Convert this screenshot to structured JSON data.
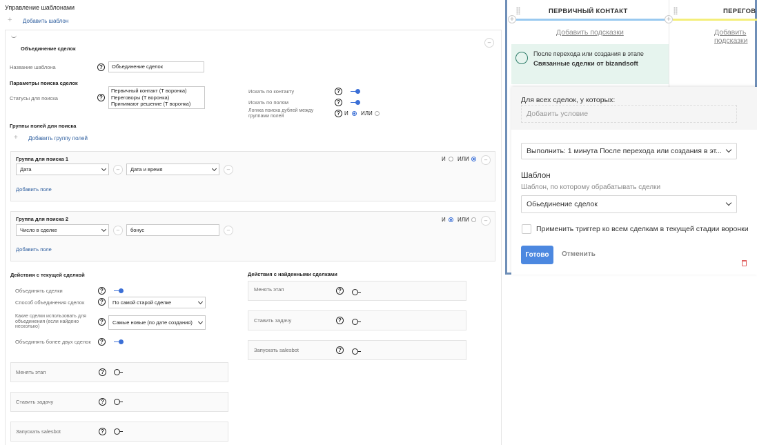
{
  "page": {
    "title": "Управление шаблонами",
    "add_template": "Добавить шаблон"
  },
  "template": {
    "heading": "Объединение сделок",
    "name_label": "Название шаблона",
    "name_value": "Объединение сделок",
    "search_params_heading": "Параметры поиска сделок",
    "statuses_label": "Статусы для поиска",
    "statuses": [
      "Первичный контакт (Т воронка)",
      "Переговоры (Т воронка)",
      "Принимают решение (Т воронка)"
    ],
    "search_by_contact": "Искать по контакту",
    "search_by_fields": "Искать по полям",
    "logic_label": "Логика поиска дублей между группами полей",
    "and": "И",
    "or": "ИЛИ",
    "field_groups_heading": "Группы полей для поиска",
    "add_field_group": "Добавить группу полей",
    "groups": [
      {
        "title": "Группа для поиска 1",
        "field": "Дата",
        "type": "Дата и время",
        "add_field": "Добавить поле",
        "and": "И",
        "or": "ИЛИ",
        "selected": "or"
      },
      {
        "title": "Группа для поиска 2",
        "field": "Число в сделке",
        "type": "бонус",
        "add_field": "Добавить поле",
        "and": "И",
        "or": "ИЛИ",
        "selected": "and"
      }
    ],
    "current_actions_heading": "Действия с текущей сделкой",
    "merge_deals": "Объединять сделки",
    "merge_method_label": "Способ объединения сделок",
    "merge_method_value": "По самой старой сделке",
    "which_deals_label": "Какие сделки использовать для объединения (если найдено несколько)",
    "which_deals_value": "Самые новые (по дате создания)",
    "merge_more_than_two": "Объединять более двух сделок",
    "current_cards": [
      "Менять этап",
      "Ставить задачу",
      "Запускать salesbot"
    ],
    "found_actions_heading": "Действия с найденными сделками",
    "found_cards": [
      "Менять этап",
      "Ставить задачу",
      "Запускать salesbot"
    ]
  },
  "panel": {
    "col1": "ПЕРВИЧНЫЙ КОНТАКТ",
    "col2": "ПЕРЕГОВ",
    "add_hint": "Добавить подсказки",
    "trigger_line1": "После перехода или создания в этапе",
    "trigger_line2": "Связанные сделки от bizandsoft",
    "for_all": "Для всех сделок, у которых:",
    "add_condition": "Добавить условие",
    "execute_value": "Выполнить: 1 минута После перехода или создания в эт...",
    "template_label": "Шаблон",
    "template_hint": "Шаблон, по которому обрабатывать сделки",
    "template_value": "Обьединение сделок",
    "apply_all": "Применить триггер ко всем сделкам в текущей стадии воронки",
    "done": "Готово",
    "cancel": "Отменить"
  },
  "colors": {
    "accent": "#3b6fd6",
    "link": "#2c5d9e",
    "panel_border": "#6f8fb8",
    "stage_bar_1": "#99c9f0",
    "stage_bar_2": "#f4ee7a",
    "trigger_bg": "#e6f4ee"
  }
}
